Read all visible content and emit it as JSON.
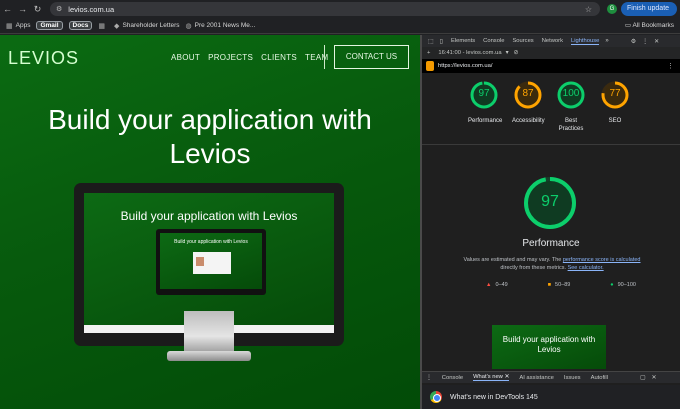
{
  "browser": {
    "url": "levios.com.ua",
    "finish_update": "Finish update",
    "profile_initial": "G"
  },
  "bookmarks": {
    "items": [
      "Apps",
      "Gmail",
      "Docs",
      "Shareholder Letters",
      "Pre 2001 News Me..."
    ],
    "all": "All Bookmarks"
  },
  "site": {
    "logo": "LEVIOS",
    "nav": [
      "ABOUT",
      "PROJECTS",
      "CLIENTS",
      "TEAM"
    ],
    "contact": "CONTACT US",
    "hero_line1": "Build your application with",
    "hero_line2": "Levios",
    "monitor_title": "Build your application with Levios",
    "mini_title": "Build your application with Levios"
  },
  "devtools": {
    "tabs": [
      "Elements",
      "Console",
      "Sources",
      "Network",
      "Lighthouse"
    ],
    "report": "16:41:00 - levios.com.ua",
    "page_url": "https://levios.com.ua/",
    "scores": [
      {
        "value": 97,
        "label": "Performance",
        "color": "#0cce6b"
      },
      {
        "value": 87,
        "label": "Accessibility",
        "color": "#ffa400"
      },
      {
        "value": 100,
        "label": "Best Practices",
        "color": "#0cce6b"
      },
      {
        "value": 77,
        "label": "SEO",
        "color": "#ffa400"
      }
    ],
    "perf_score": 97,
    "perf_title": "Performance",
    "perf_desc_1": "Values are estimated and may vary. The",
    "perf_desc_link1": "performance score is calculated",
    "perf_desc_2": "directly from these metrics.",
    "perf_desc_link2": "See calculator.",
    "legend": [
      "0–49",
      "50–89",
      "90–100"
    ],
    "thumb_title": "Build your application with Levios",
    "drawer_tabs": [
      "Console",
      "What's new",
      "AI assistance",
      "Issues",
      "Autofill"
    ],
    "whats_new": "What's new in DevTools 145"
  }
}
